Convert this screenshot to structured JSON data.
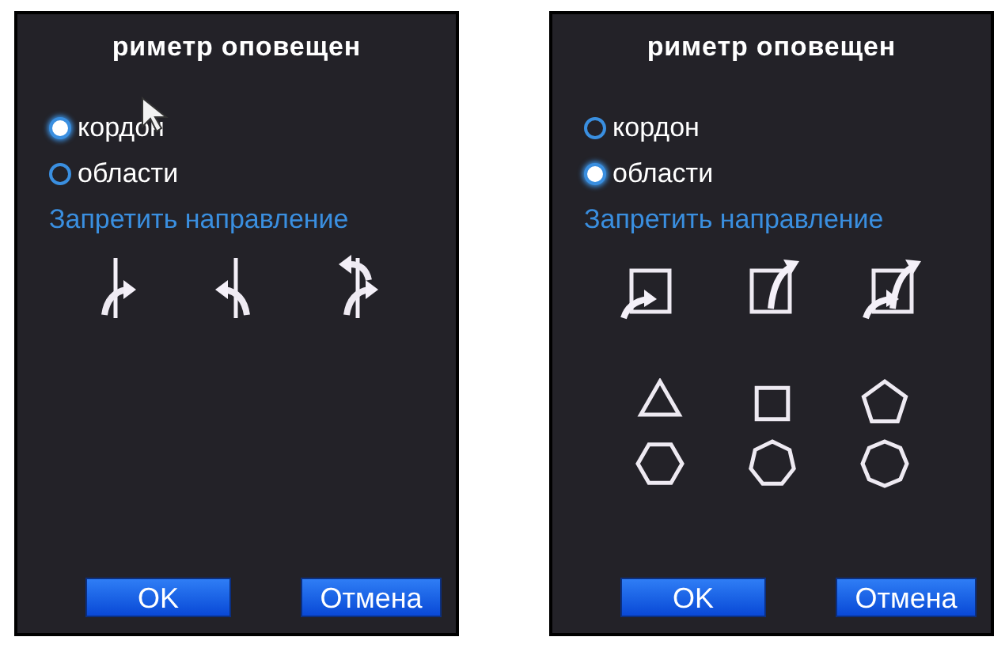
{
  "panels": [
    {
      "title": "риметр оповещен",
      "cursor": true,
      "radios": [
        {
          "label": "кордон",
          "selected": true
        },
        {
          "label": "области",
          "selected": false
        }
      ],
      "section_title": "Запретить направление",
      "buttons": [
        "OK",
        "Отмена"
      ]
    },
    {
      "title": "риметр оповещен",
      "cursor": false,
      "radios": [
        {
          "label": "кордон",
          "selected": false
        },
        {
          "label": "области",
          "selected": true
        }
      ],
      "section_title": "Запретить направление",
      "buttons": [
        "OK",
        "Отмена"
      ]
    }
  ]
}
